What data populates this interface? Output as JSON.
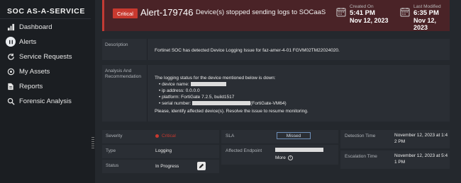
{
  "sidebar": {
    "brand": "SOC AS-A-SERVICE",
    "items": [
      {
        "label": "Dashboard",
        "icon": "dashboard-icon"
      },
      {
        "label": "Alerts",
        "icon": "alert-icon"
      },
      {
        "label": "Service Requests",
        "icon": "refresh-icon"
      },
      {
        "label": "My Assets",
        "icon": "target-icon"
      },
      {
        "label": "Reports",
        "icon": "document-icon"
      },
      {
        "label": "Forensic Analysis",
        "icon": "magnifier-icon"
      }
    ]
  },
  "alert": {
    "severity_badge": "Critical",
    "id": "Alert-179746",
    "title": "Device(s) stopped sending logs to SOCaaS",
    "created_label": "Created On",
    "created_time": "5:41 PM",
    "created_date": "Nov 12, 2023",
    "modified_label": "Last Modified",
    "modified_time": "6:35 PM",
    "modified_date": "Nov 12, 2023"
  },
  "description": {
    "label": "Description",
    "text": "Fortinet SOC has detected Device Logging Issue for faz-amer-4-01 FGVM02TM22024020."
  },
  "analysis": {
    "label": "Analysis And Recommendation",
    "intro": "The logging status for the device mentioned below is down:",
    "device_name_label": "device name:",
    "ip_address": "ip address: 0.0.0.0",
    "platform": "platform: FortiGate 7.2.5, build1517",
    "serial_label": "serial number:",
    "serial_suffix": "(FortiGate-VM64)",
    "footer": "Please, identify affected device(s). Resolve the issue to resume monitoring."
  },
  "details": {
    "severity_label": "Severity",
    "severity_value": "Critical",
    "type_label": "Type",
    "type_value": "Logging",
    "status_label": "Status",
    "status_value": "In Progress",
    "sla_label": "SLA",
    "sla_value": "Missed",
    "affected_label": "Affected Endpoint",
    "more_label": "More",
    "detection_label": "Detection Time",
    "detection_line1": "November 12, 2023 at 1:4",
    "detection_line2": "2 PM",
    "escalation_label": "Escalation Time",
    "escalation_line1": "November 12, 2023 at 5:4",
    "escalation_line2": "1 PM"
  },
  "colors": {
    "critical": "#c8392f",
    "header_bg": "#4a2327",
    "sla_border": "#6d8fb8"
  }
}
